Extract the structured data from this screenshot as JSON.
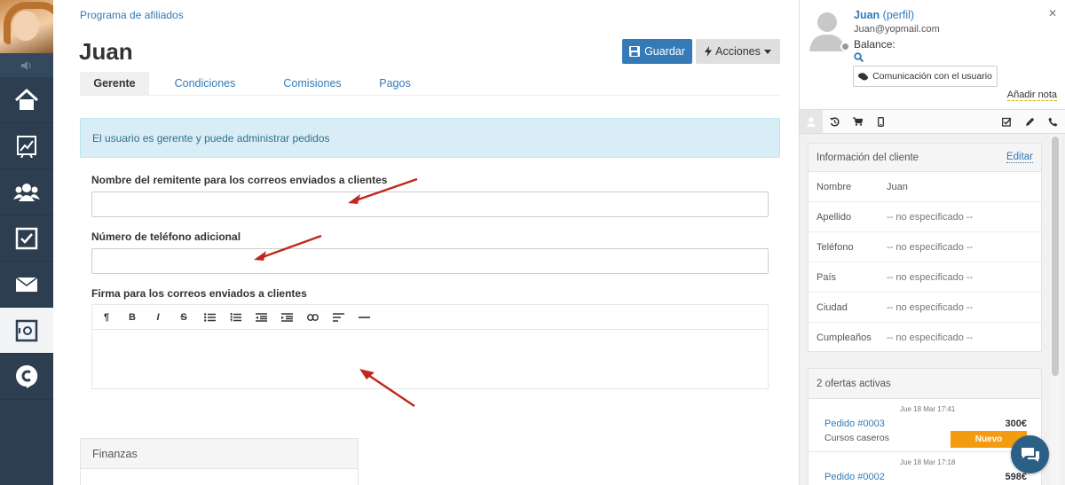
{
  "nav": {
    "items": [
      {
        "icon": "home-icon"
      },
      {
        "icon": "chart-icon"
      },
      {
        "icon": "users-icon"
      },
      {
        "icon": "tasks-icon"
      },
      {
        "icon": "mail-icon"
      },
      {
        "icon": "safe-icon",
        "active": true
      },
      {
        "icon": "brand-c-icon"
      }
    ]
  },
  "header": {
    "breadcrumb": "Programa de afiliados",
    "title": "Juan",
    "save_label": "Guardar",
    "actions_label": "Acciones"
  },
  "tabs": [
    {
      "label": "Gerente",
      "active": true
    },
    {
      "label": "Condiciones"
    },
    {
      "label": "Comisiones"
    },
    {
      "label": "Pagos"
    }
  ],
  "alert": "El usuario es gerente y puede administrar pedidos",
  "form": {
    "sender_name_label": "Nombre del remitente para los correos enviados a clientes",
    "sender_name_value": "",
    "phone_label": "Número de teléfono adicional",
    "phone_value": "",
    "signature_label": "Firma para los correos enviados a clientes",
    "signature_value": "",
    "toolbar": [
      "paragraph",
      "bold",
      "italic",
      "strikethrough",
      "bullet-list",
      "numbered-list",
      "outdent",
      "indent",
      "link",
      "align",
      "horizontal-rule"
    ]
  },
  "finanzas": {
    "title": "Finanzas"
  },
  "customer": {
    "name": "Juan",
    "profile_link": "(perfil)",
    "email": "Juan@yopmail.com",
    "balance_label": "Balance:",
    "communication_button": "Comunicación con el usuario",
    "add_note": "Añadir nota",
    "info_title": "Información del cliente",
    "edit_label": "Editar",
    "fields": [
      {
        "key": "Nombre",
        "value": "Juan"
      },
      {
        "key": "Apellido",
        "value": "-- no especificado --"
      },
      {
        "key": "Teléfono",
        "value": "-- no especificado --"
      },
      {
        "key": "País",
        "value": "-- no especificado --"
      },
      {
        "key": "Ciudad",
        "value": "-- no especificado --"
      },
      {
        "key": "Cumpleaños",
        "value": "-- no especificado --"
      }
    ],
    "orders_title": "2 ofertas activas",
    "orders": [
      {
        "date": "Jue 18 Mar 17:41",
        "link": "Pedido #0003",
        "price": "300€",
        "product": "Cursos caseros",
        "status": "Nuevo"
      },
      {
        "date": "Jue 18 Mar 17:18",
        "link": "Pedido #0002",
        "price": "598€"
      }
    ]
  }
}
